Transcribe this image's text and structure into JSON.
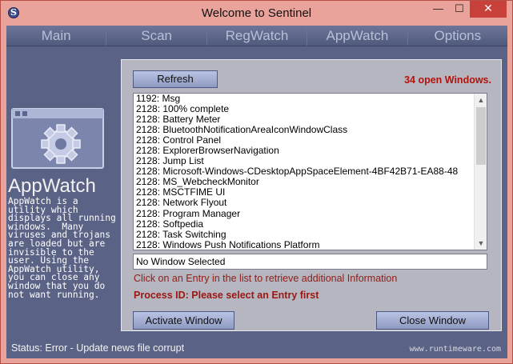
{
  "window": {
    "title": "Welcome to Sentinel",
    "minimize_glyph": "—",
    "maximize_glyph": "☐",
    "close_glyph": "✕"
  },
  "tabs": [
    "Main",
    "Scan",
    "RegWatch",
    "AppWatch",
    "Options"
  ],
  "sidebar": {
    "title": "AppWatch",
    "description": "AppWatch is a utility which displays all running windows.  Many viruses and trojans are loaded but are invisible to the user. Using the AppWatch utility, you can close any window that you do not want running."
  },
  "panel": {
    "refresh_label": "Refresh",
    "window_count": "34 open Windows.",
    "windows": [
      "1192: Msg",
      "2128: 100% complete",
      "2128: Battery Meter",
      "2128: BluetoothNotificationAreaIconWindowClass",
      "2128: Control Panel",
      "2128: ExplorerBrowserNavigation",
      "2128: Jump List",
      "2128: Microsoft-Windows-CDesktopAppSpaceElement-4BF42B71-EA88-48",
      "2128: MS_WebcheckMonitor",
      "2128: MSCTFIME UI",
      "2128: Network Flyout",
      "2128: Program Manager",
      "2128: Softpedia",
      "2128: Task Switching",
      "2128: Windows Push Notifications Platform"
    ],
    "selected_window": "No Window Selected",
    "hint": "Click on an Entry in the list to retrieve additional Information",
    "process_id": "Process ID: Please select an Entry first",
    "activate_label": "Activate Window",
    "close_label": "Close Window"
  },
  "status": {
    "text": "Status: Error - Update news file corrupt",
    "watermark": "www.runtimeware.com"
  },
  "colors": {
    "accent": "#b3130d",
    "client_bg": "#5a6385",
    "panel_bg": "#b6b6c0",
    "frame": "#e9a39b"
  },
  "icons": [
    "sentinel-app-icon",
    "appwatch-gear-window-icon",
    "scroll-up-arrow-icon",
    "scroll-down-arrow-icon"
  ]
}
